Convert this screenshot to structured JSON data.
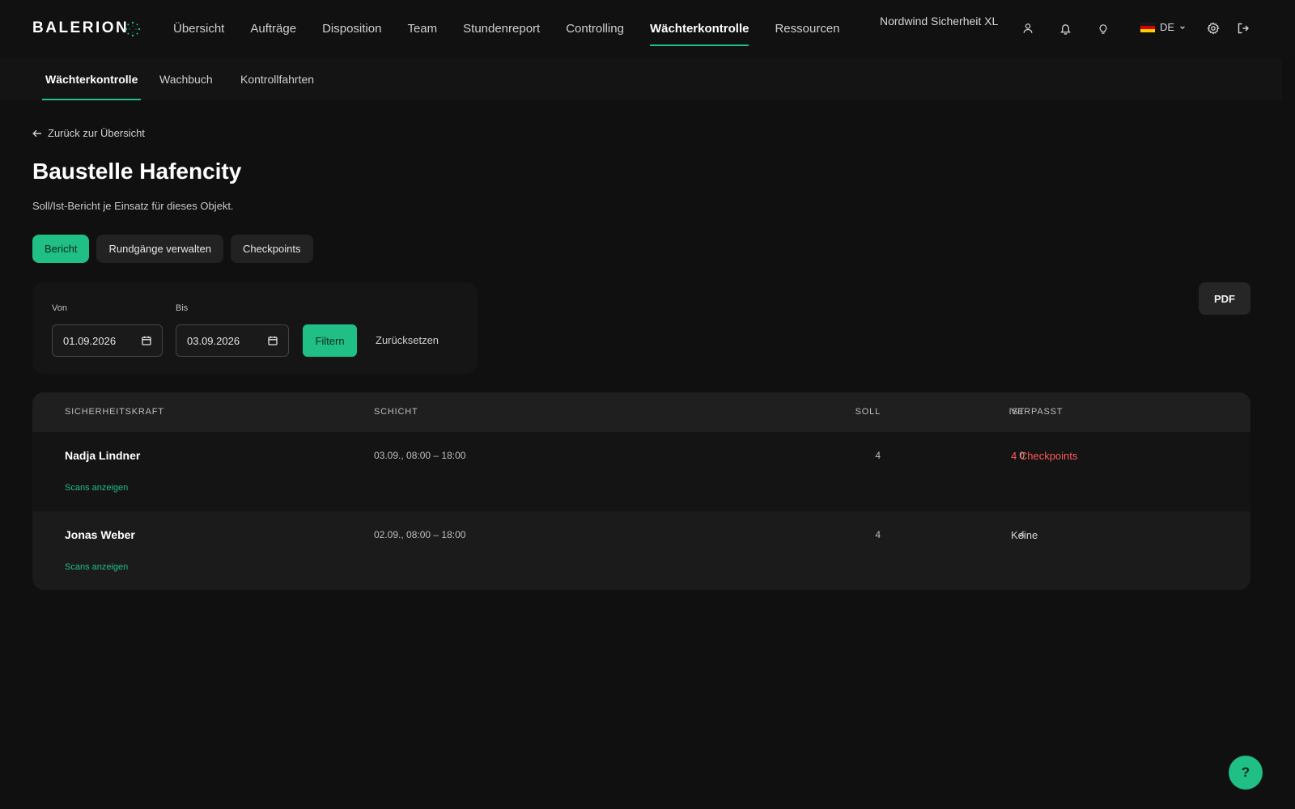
{
  "brand": "BALERION",
  "nav": {
    "items": [
      "Übersicht",
      "Aufträge",
      "Disposition",
      "Team",
      "Stundenreport",
      "Controlling",
      "Wächterkontrolle",
      "Ressourcen"
    ],
    "active": "Wächterkontrolle"
  },
  "header": {
    "company": "Nordwind Sicherheit XL",
    "language": "DE",
    "icons": [
      "user-icon",
      "bell-icon",
      "lightbulb-icon",
      "settings-icon",
      "logout-icon"
    ]
  },
  "subnav": {
    "items": [
      "Wächterkontrolle",
      "Wachbuch",
      "Kontrollfahrten"
    ],
    "active": "Wächterkontrolle"
  },
  "page": {
    "back_label": "Zurück zur Übersicht",
    "title": "Baustelle Hafencity",
    "subtitle": "Soll/Ist-Bericht je Einsatz für dieses Objekt."
  },
  "tabs": {
    "items": [
      "Bericht",
      "Rundgänge verwalten",
      "Checkpoints"
    ],
    "active": "Bericht"
  },
  "filter": {
    "from_label": "Von",
    "from_value": "01.09.2026",
    "to_label": "Bis",
    "to_value": "03.09.2026",
    "filter_label": "Filtern",
    "reset_label": "Zurücksetzen"
  },
  "pdf_label": "PDF",
  "table": {
    "headers": {
      "guard": "SICHERHEITSKRAFT",
      "shift": "SCHICHT",
      "target": "SOLL",
      "actual": "IST",
      "missed": "VERPASST"
    },
    "rows": [
      {
        "guard": "Nadja Lindner",
        "shift": "03.09., 08:00 – 18:00",
        "target": "4",
        "actual": "0",
        "missed": "4 Checkpoints",
        "missed_status": "alert",
        "link": "Scans anzeigen"
      },
      {
        "guard": "Jonas Weber",
        "shift": "02.09., 08:00 – 18:00",
        "target": "4",
        "actual": "4",
        "missed": "Keine",
        "missed_status": "ok",
        "link": "Scans anzeigen"
      }
    ]
  },
  "help_label": "?",
  "colors": {
    "accent": "#1fbf85",
    "alert": "#ff5a5a",
    "background": "#101010"
  }
}
